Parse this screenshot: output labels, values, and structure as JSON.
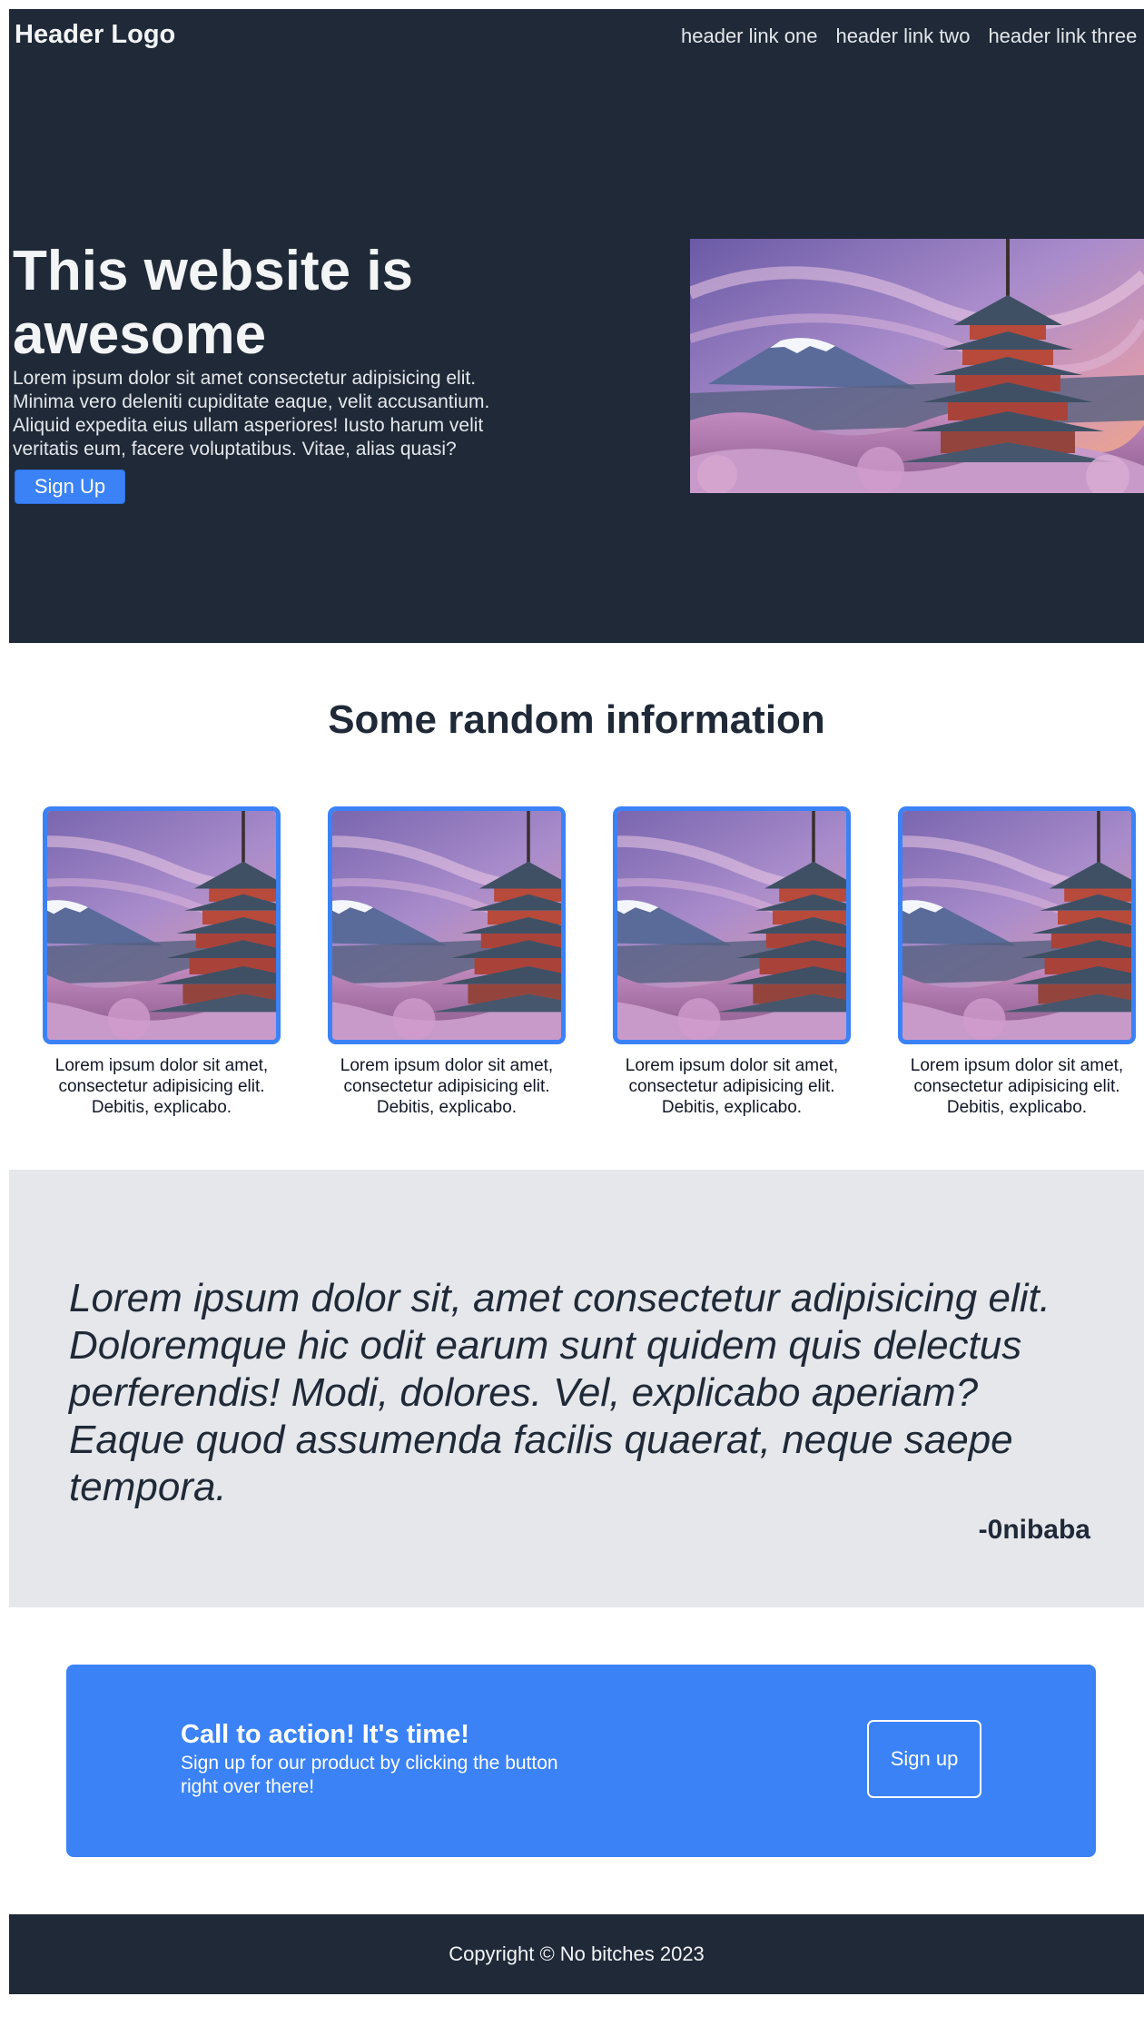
{
  "header": {
    "logo": "Header Logo",
    "nav": [
      "header link one",
      "header link two",
      "header link three"
    ]
  },
  "hero": {
    "title": "This website is awesome",
    "description": "Lorem ipsum dolor sit amet consectetur adipisicing elit. Minima vero deleniti cupiditate eaque, velit accusantium. Aliquid expedita eius ullam asperiores! Iusto harum velit veritatis eum, facere voluptatibus. Vitae, alias quasi?",
    "button_label": "Sign Up",
    "image_icon": "pagoda-mountain-photo"
  },
  "info": {
    "title": "Some random information",
    "cards": [
      {
        "text": "Lorem ipsum dolor sit amet, consectetur adipisicing elit. Debitis, explicabo."
      },
      {
        "text": "Lorem ipsum dolor sit amet, consectetur adipisicing elit. Debitis, explicabo."
      },
      {
        "text": "Lorem ipsum dolor sit amet, consectetur adipisicing elit. Debitis, explicabo."
      },
      {
        "text": "Lorem ipsum dolor sit amet, consectetur adipisicing elit. Debitis, explicabo."
      }
    ]
  },
  "quote": {
    "text": "Lorem ipsum dolor sit, amet consectetur adipisicing elit. Doloremque hic odit earum sunt quidem quis delectus perferendis! Modi, dolores. Vel, explicabo aperiam? Eaque quod assumenda facilis quaerat, neque saepe tempora.",
    "author": "-0nibaba"
  },
  "cta": {
    "title": "Call to action! It's time!",
    "description": "Sign up for our product by clicking the button right over there!",
    "button_label": "Sign up"
  },
  "footer": {
    "text": "Copyright © No bitches 2023"
  },
  "colors": {
    "dark": "#1f2937",
    "accent": "#3b82f6",
    "light_gray": "#e5e7eb",
    "white": "#ffffff"
  }
}
